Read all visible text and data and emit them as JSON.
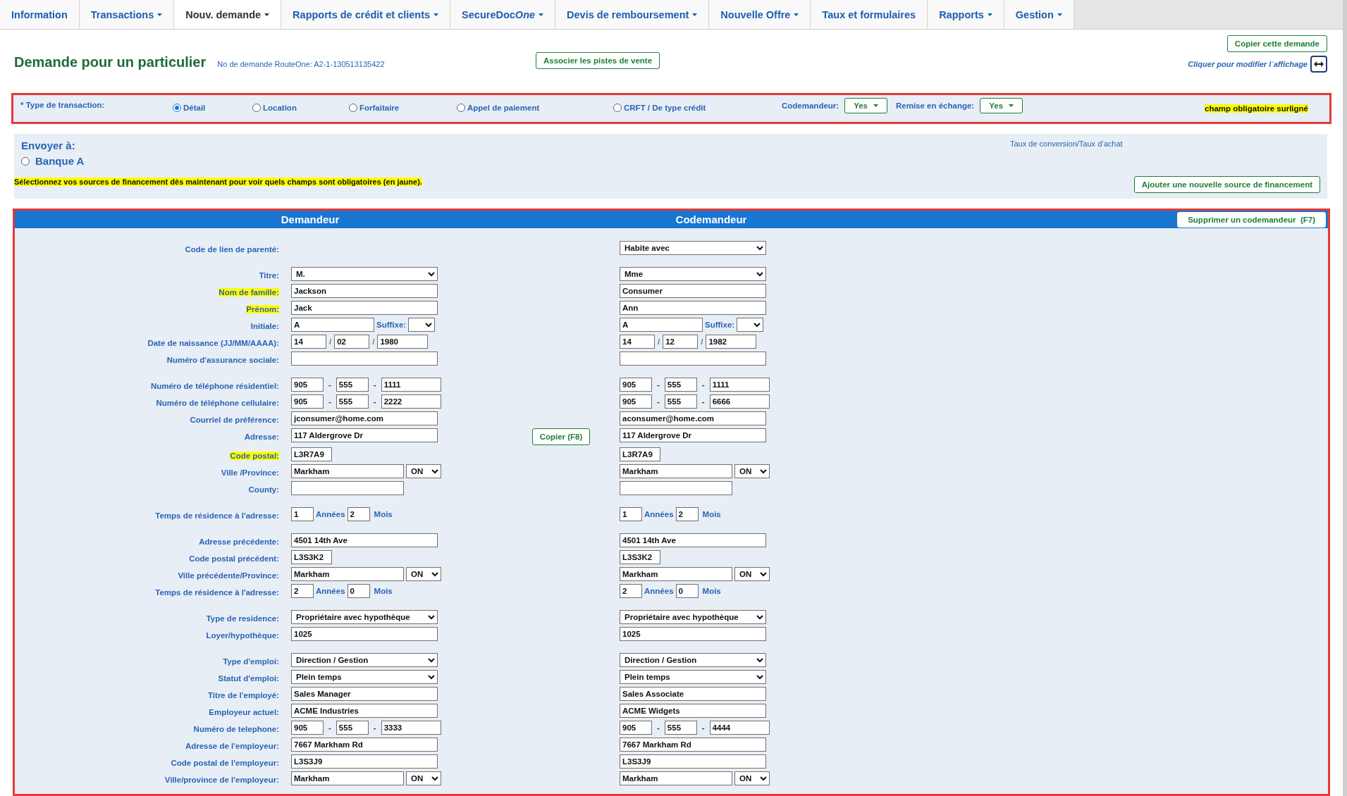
{
  "nav": {
    "tabs": [
      {
        "label": "Information",
        "dropdown": false,
        "selected": false
      },
      {
        "label": "Transactions",
        "dropdown": true,
        "selected": false
      },
      {
        "label": "Nouv. demande",
        "dropdown": true,
        "selected": true
      },
      {
        "label": "Rapports de crédit et clients",
        "dropdown": true,
        "selected": false
      },
      {
        "label": "SecureDoc",
        "italic_suffix": "One",
        "dropdown": true,
        "selected": false
      },
      {
        "label": "Devis de remboursement",
        "dropdown": true,
        "selected": false
      },
      {
        "label": "Nouvelle Offre",
        "dropdown": true,
        "selected": false
      },
      {
        "label": "Taux et formulaires",
        "dropdown": false,
        "selected": false
      },
      {
        "label": "Rapports",
        "dropdown": true,
        "selected": false
      },
      {
        "label": "Gestion",
        "dropdown": true,
        "selected": false
      }
    ]
  },
  "header": {
    "title": "Demande pour un particulier",
    "request_number": "No de demande RouteOne: A2-1-130513135422",
    "link_leads_button": "Associer les pistes de vente",
    "copy_request_button": "Copier cette demande",
    "layout_hint": "Cliquer pour modifier l´affichage"
  },
  "transaction": {
    "label": "* Type de transaction:",
    "options": [
      {
        "label": "Détail",
        "selected": true
      },
      {
        "label": "Location",
        "selected": false
      },
      {
        "label": "Forfaitaire",
        "selected": false
      },
      {
        "label": "Appel de paiement",
        "selected": false
      },
      {
        "label": "CRFT / De type crédit",
        "selected": false
      }
    ],
    "coapplicant": {
      "label": "Codemandeur:",
      "value": "Yes"
    },
    "trade_in": {
      "label": "Remise en échange:",
      "value": "Yes"
    },
    "legend": "champ obligatoire surligné"
  },
  "send_to": {
    "title": "Envoyer à:",
    "lenders": [
      {
        "label": "Banque A",
        "selected": false
      }
    ],
    "rates_link": "Taux de conversion/Taux d’achat",
    "note": "Sélectionnez vos sources de financement dès maintenant pour voir quels champs sont obligatoires (en jaune).",
    "add_button": "Ajouter une nouvelle source de financement"
  },
  "form": {
    "applicant_heading": "Demandeur",
    "coapplicant_heading": "Codemandeur",
    "remove_button": "Supprimer un codemandeur  (F7)",
    "sections": [
      {
        "rows": [
          {
            "label": "Code de lien de parenté:",
            "kind": "select",
            "required": false,
            "coapplicant": {
              "value": "Habite avec"
            }
          }
        ]
      },
      {
        "rows": [
          {
            "label": "Titre:",
            "kind": "select",
            "required": false,
            "applicant": {
              "value": "M."
            },
            "coapplicant": {
              "value": "Mme"
            }
          },
          {
            "label": "Nom de famille:",
            "kind": "text",
            "required": true,
            "applicant": {
              "value": "Jackson"
            },
            "coapplicant": {
              "value": "Consumer"
            }
          },
          {
            "label": "Prénom:",
            "kind": "text",
            "required": true,
            "applicant": {
              "value": "Jack"
            },
            "coapplicant": {
              "value": "Ann"
            }
          },
          {
            "label": "Initiale:",
            "kind": "initial",
            "required": false,
            "applicant": {
              "value": "A",
              "suffix_label": "Suffixe:"
            },
            "coapplicant": {
              "value": "A",
              "suffix_label": "Suffixe:"
            }
          },
          {
            "label": "Date de naissance (JJ/MM/AAAA):",
            "kind": "date",
            "separator": "/",
            "required": false,
            "applicant": {
              "parts": [
                "14",
                "02",
                "1980"
              ]
            },
            "coapplicant": {
              "parts": [
                "14",
                "12",
                "1982"
              ]
            }
          },
          {
            "label": "Numéro d'assurance sociale:",
            "kind": "text",
            "required": false,
            "applicant": {},
            "coapplicant": {}
          }
        ]
      },
      {
        "rows": [
          {
            "label": "Numéro de téléphone résidentiel:",
            "kind": "phone",
            "separator": "-",
            "required": false,
            "applicant": {
              "parts": [
                "905",
                "555",
                "1111"
              ]
            },
            "coapplicant": {
              "parts": [
                "905",
                "555",
                "1111"
              ]
            }
          },
          {
            "label": "Numéro de téléphone cellulaire:",
            "kind": "phone",
            "separator": "-",
            "required": false,
            "applicant": {
              "parts": [
                "905",
                "555",
                "2222"
              ]
            },
            "coapplicant": {
              "parts": [
                "905",
                "555",
                "6666"
              ]
            }
          },
          {
            "label": "Courriel de préférence:",
            "kind": "text",
            "required": false,
            "applicant": {
              "value": "jconsumer@home.com"
            },
            "coapplicant": {
              "value": "aconsumer@home.com"
            }
          },
          {
            "label": "Adresse:",
            "kind": "text",
            "required": false,
            "action": "Copier (F8)",
            "applicant": {
              "value": "117 Aldergrove Dr"
            },
            "coapplicant": {
              "value": "117 Aldergrove Dr"
            }
          },
          {
            "label": "Code postal:",
            "kind": "short_text",
            "required": true,
            "applicant": {
              "value": "L3R7A9"
            },
            "coapplicant": {
              "value": "L3R7A9"
            }
          },
          {
            "label": "Ville /Province:",
            "kind": "city",
            "required": false,
            "applicant": {
              "value": "Markham",
              "province": "ON"
            },
            "coapplicant": {
              "value": "Markham",
              "province": "ON"
            }
          },
          {
            "label": "County:",
            "kind": "medium_text",
            "required": false,
            "applicant": {},
            "coapplicant": {}
          }
        ]
      },
      {
        "rows": [
          {
            "label": "Temps de résidence à l'adresse:",
            "kind": "duration",
            "required": false,
            "applicant": {
              "years": "1",
              "years_label": "Années",
              "months": "2",
              "months_label": "Mois"
            },
            "coapplicant": {
              "years": "1",
              "years_label": "Années",
              "months": "2",
              "months_label": "Mois"
            }
          }
        ]
      },
      {
        "rows": [
          {
            "label": "Adresse précédente:",
            "kind": "text",
            "required": false,
            "applicant": {
              "value": "4501 14th Ave"
            },
            "coapplicant": {
              "value": "4501 14th Ave"
            }
          },
          {
            "label": "Code postal précédent:",
            "kind": "short_text",
            "required": false,
            "applicant": {
              "value": "L3S3K2"
            },
            "coapplicant": {
              "value": "L3S3K2"
            }
          },
          {
            "label": "Ville précédente/Province:",
            "kind": "city",
            "required": false,
            "applicant": {
              "value": "Markham",
              "province": "ON"
            },
            "coapplicant": {
              "value": "Markham",
              "province": "ON"
            }
          },
          {
            "label": "Temps de résidence à l'adresse:",
            "kind": "duration",
            "required": false,
            "applicant": {
              "years": "2",
              "years_label": "Années",
              "months": "0",
              "months_label": "Mois"
            },
            "coapplicant": {
              "years": "2",
              "years_label": "Années",
              "months": "0",
              "months_label": "Mois"
            }
          }
        ]
      },
      {
        "rows": [
          {
            "label": "Type de residence:",
            "kind": "select",
            "required": false,
            "applicant": {
              "value": "Propriétaire avec hypothèque"
            },
            "coapplicant": {
              "value": "Propriétaire avec hypothèque"
            }
          },
          {
            "label": "Loyer/hypothèque:",
            "kind": "text",
            "required": false,
            "applicant": {
              "value": "1025"
            },
            "coapplicant": {
              "value": "1025"
            }
          }
        ]
      },
      {
        "rows": [
          {
            "label": "Type d'emploi:",
            "kind": "select",
            "required": false,
            "applicant": {
              "value": "Direction / Gestion"
            },
            "coapplicant": {
              "value": "Direction / Gestion"
            }
          },
          {
            "label": "Statut d'emploi:",
            "kind": "select",
            "required": false,
            "applicant": {
              "value": "Plein temps"
            },
            "coapplicant": {
              "value": "Plein temps"
            }
          },
          {
            "label": "Titre de l'employé:",
            "kind": "text",
            "required": false,
            "applicant": {
              "value": "Sales Manager"
            },
            "coapplicant": {
              "value": "Sales Associate"
            }
          },
          {
            "label": "Employeur actuel:",
            "kind": "text",
            "required": false,
            "applicant": {
              "value": "ACME Industries"
            },
            "coapplicant": {
              "value": "ACME Widgets"
            }
          },
          {
            "label": "Numéro de telephone:",
            "kind": "phone",
            "separator": "-",
            "required": false,
            "applicant": {
              "parts": [
                "905",
                "555",
                "3333"
              ]
            },
            "coapplicant": {
              "parts": [
                "905",
                "555",
                "4444"
              ]
            }
          },
          {
            "label": "Adresse de l'employeur:",
            "kind": "text",
            "required": false,
            "applicant": {
              "value": "7667 Markham Rd"
            },
            "coapplicant": {
              "value": "7667 Markham Rd"
            }
          },
          {
            "label": "Code postal de l'employeur:",
            "kind": "text",
            "required": false,
            "applicant": {
              "value": "L3S3J9"
            },
            "coapplicant": {
              "value": "L3S3J9"
            }
          },
          {
            "label": "Ville/province de l'employeur:",
            "kind": "city",
            "required": false,
            "applicant": {
              "value": "Markham",
              "province": "ON"
            },
            "coapplicant": {
              "value": "Markham",
              "province": "ON"
            }
          }
        ]
      }
    ]
  }
}
